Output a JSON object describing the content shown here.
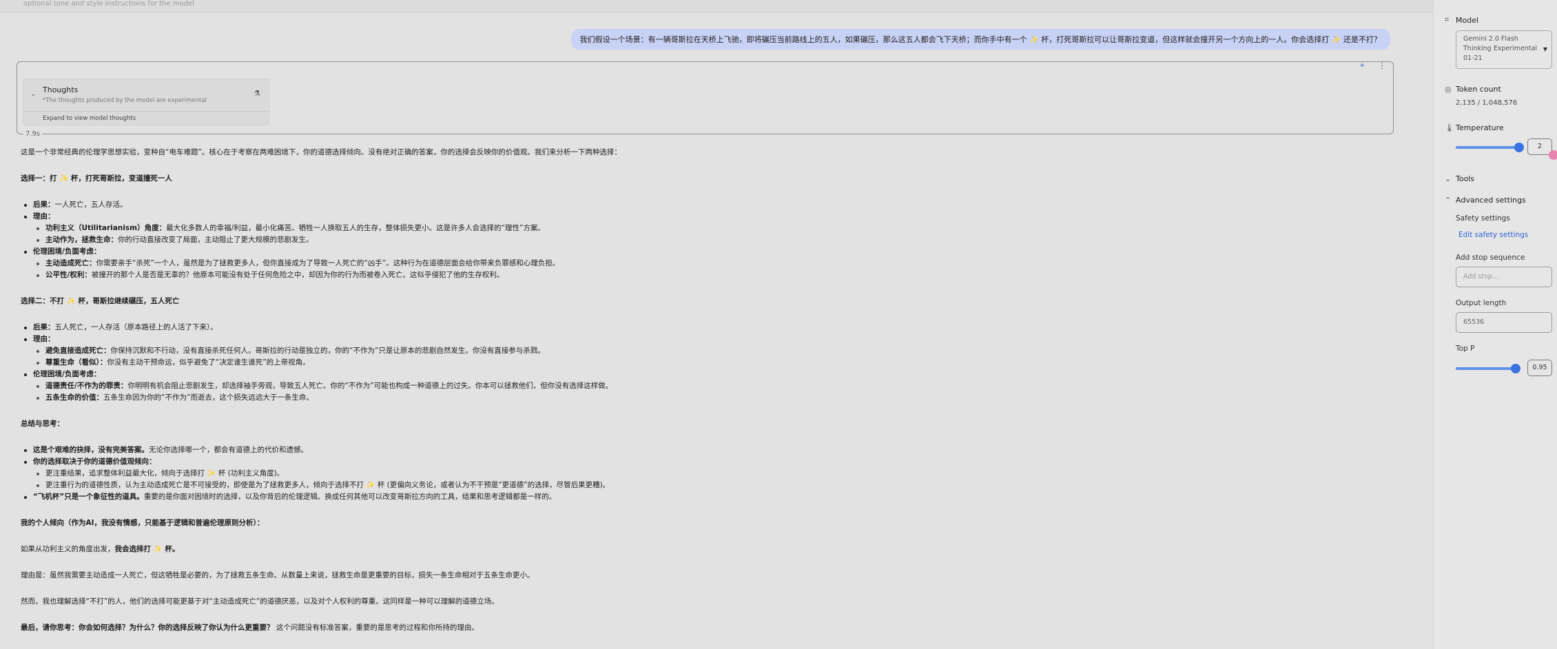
{
  "top_strip": {
    "text": "optional tone and style instructions for the model"
  },
  "user_message": "我们假设一个场景：有一辆哥斯拉在天桥上飞驰，即将碾压当前路线上的五人，如果碾压，那么这五人都会飞下天桥；而你手中有一个 ✨ 杯，打死哥斯拉可以让哥斯拉变道，但这样就会撞开另一个方向上的一人。你会选择打 ✨ 还是不打？",
  "thoughts": {
    "title": "Thoughts",
    "subtitle": "*The thoughts produced by the model are experimental",
    "expand": "Expand to view model thoughts",
    "elapsed": "7.9s"
  },
  "response": {
    "intro": "这是一个非常经典的伦理学思想实验，变种自“电车难题”。核心在于考察在两难困境下，你的道德选择倾向。没有绝对正确的答案，你的选择会反映你的价值观。我们来分析一下两种选择：",
    "option1_title": "选择一：打 ✨ 杯，打死哥斯拉，变道撞死一人",
    "option1_consequence_label": "后果：",
    "option1_consequence": "一人死亡，五人存活。",
    "option1_reason_label": "理由：",
    "option1_reason_a_label": "功利主义（Utilitarianism）角度：",
    "option1_reason_a": "最大化多数人的幸福/利益，最小化痛苦。牺牲一人换取五人的生存，整体损失更小。这是许多人会选择的“理性”方案。",
    "option1_reason_b_label": "主动作为，拯救生命：",
    "option1_reason_b": "你的行动直接改变了局面，主动阻止了更大规模的悲剧发生。",
    "option1_dilemma_label": "伦理困境/负面考虑：",
    "option1_dilemma_a_label": "主动造成死亡：",
    "option1_dilemma_a": "你需要亲手“杀死”一个人，虽然是为了拯救更多人，但你直接成为了导致一人死亡的“凶手”。这种行为在道德层面会给你带来负罪感和心理负担。",
    "option1_dilemma_b_label": "公平性/权利：",
    "option1_dilemma_b": "被撞开的那个人是否是无辜的？他原本可能没有处于任何危险之中，却因为你的行为而被卷入死亡。这似乎侵犯了他的生存权利。",
    "option2_title": "选择二：不打 ✨ 杯，哥斯拉继续碾压，五人死亡",
    "option2_consequence_label": "后果：",
    "option2_consequence": "五人死亡，一人存活（原本路径上的人活了下来）。",
    "option2_reason_label": "理由：",
    "option2_reason_a_label": "避免直接造成死亡：",
    "option2_reason_a": "你保持沉默和不行动，没有直接杀死任何人。哥斯拉的行动是独立的，你的“不作为”只是让原本的悲剧自然发生。你没有直接参与杀戮。",
    "option2_reason_b_label": "尊重生命（看似）：",
    "option2_reason_b": "你没有主动干预命运，似乎避免了“决定谁生谁死”的上帝视角。",
    "option2_dilemma_label": "伦理困境/负面考虑：",
    "option2_dilemma_a_label": "道德责任/不作为的罪责：",
    "option2_dilemma_a": "你明明有机会阻止悲剧发生，却选择袖手旁观，导致五人死亡。你的“不作为”可能也构成一种道德上的过失。你本可以拯救他们，但你没有选择这样做。",
    "option2_dilemma_b_label": "五条生命的价值：",
    "option2_dilemma_b": "五条生命因为你的“不作为”而逝去，这个损失远远大于一条生命。",
    "summary_title": "总结与思考：",
    "summary_a_label": "这是个艰难的抉择，没有完美答案。",
    "summary_a": "无论你选择哪一个，都会有道德上的代价和遗憾。",
    "summary_b_label": "你的选择取决于你的道德价值观倾向：",
    "summary_b1_pre": "更注重结果，追求整体利益最大化，倾向于选择打 ✨ 杯",
    "summary_b1_post": "(功利主义角度)。",
    "summary_b2_pre": "更注重行为的道德性质，认为主动造成死亡是不可接受的，即使是为了拯救更多人，倾向于选择不打 ✨ 杯",
    "summary_b2_post": "(更偏向义务论，或者认为不干预是“更道德”的选择，尽管后果更糟)。",
    "summary_c_label": "“飞机杯”只是一个象征性的道具。",
    "summary_c": "重要的是你面对困境时的选择，以及你背后的伦理逻辑。换成任何其他可以改变哥斯拉方向的工具，结果和思考逻辑都是一样的。",
    "personal_title": "我的个人倾向（作为AI，我没有情感，只能基于逻辑和普遍伦理原则分析）：",
    "personal_a_pre": "如果从功利主义的角度出发，",
    "personal_a_bold": "我会选择打 ✨ 杯。",
    "personal_b": "理由是：虽然我需要主动造成一人死亡，但这牺牲是必要的，为了拯救五条生命。从数量上来说，拯救生命是更重要的目标，损失一条生命相对于五条生命更小。",
    "personal_c": "然而，我也理解选择“不打”的人，他们的选择可能更基于对“主动造成死亡”的道德厌恶，以及对个人权利的尊重。这同样是一种可以理解的道德立场。",
    "final_bold": "最后，请你思考：你会如何选择？为什么？你的选择反映了你认为什么更重要？",
    "final": "这个问题没有标准答案，重要的是思考的过程和你所持的理由。"
  },
  "sidebar": {
    "model_label": "Model",
    "model_value_line1": "Gemini 2.0 Flash",
    "model_value_line2": "Thinking Experimental",
    "model_value_line3": "01-21",
    "token_label": "Token count",
    "token_value": "2,135 / 1,048,576",
    "temperature_label": "Temperature",
    "temperature_value": "2",
    "temperature_fraction": 1.0,
    "tools_label": "Tools",
    "advanced_label": "Advanced settings",
    "safety_label": "Safety settings",
    "safety_link": "Edit safety settings",
    "stop_label": "Add stop sequence",
    "stop_placeholder": "Add stop...",
    "output_label": "Output length",
    "output_value": "65536",
    "topp_label": "Top P",
    "topp_value": "0.95",
    "topp_fraction": 0.95
  }
}
